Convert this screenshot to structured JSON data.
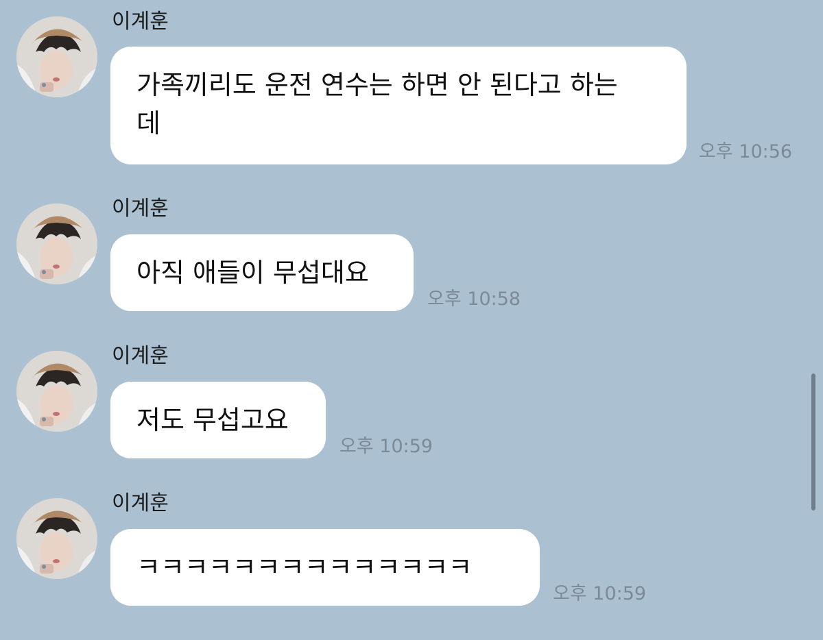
{
  "colors": {
    "background": "#abc1d1",
    "bubble": "#ffffff",
    "timestamp": "#7b8a97",
    "scrollbar": "#6f7f8c"
  },
  "messages": [
    {
      "sender": "이계훈",
      "text_lines": [
        "가족끼리도 운전 연수는 하면 안 된다고 하는",
        "데"
      ],
      "time": "오후 10:56",
      "avatar_icon": "profile-photo"
    },
    {
      "sender": "이계훈",
      "text_lines": [
        "아직 애들이 무섭대요"
      ],
      "time": "오후 10:58",
      "avatar_icon": "profile-photo"
    },
    {
      "sender": "이계훈",
      "text_lines": [
        "저도 무섭고요"
      ],
      "time": "오후 10:59",
      "avatar_icon": "profile-photo"
    },
    {
      "sender": "이계훈",
      "text_lines": [
        "ㅋㅋㅋㅋㅋㅋㅋㅋㅋㅋㅋㅋㅋㅋ"
      ],
      "time": "오후 10:59",
      "avatar_icon": "profile-photo"
    }
  ]
}
